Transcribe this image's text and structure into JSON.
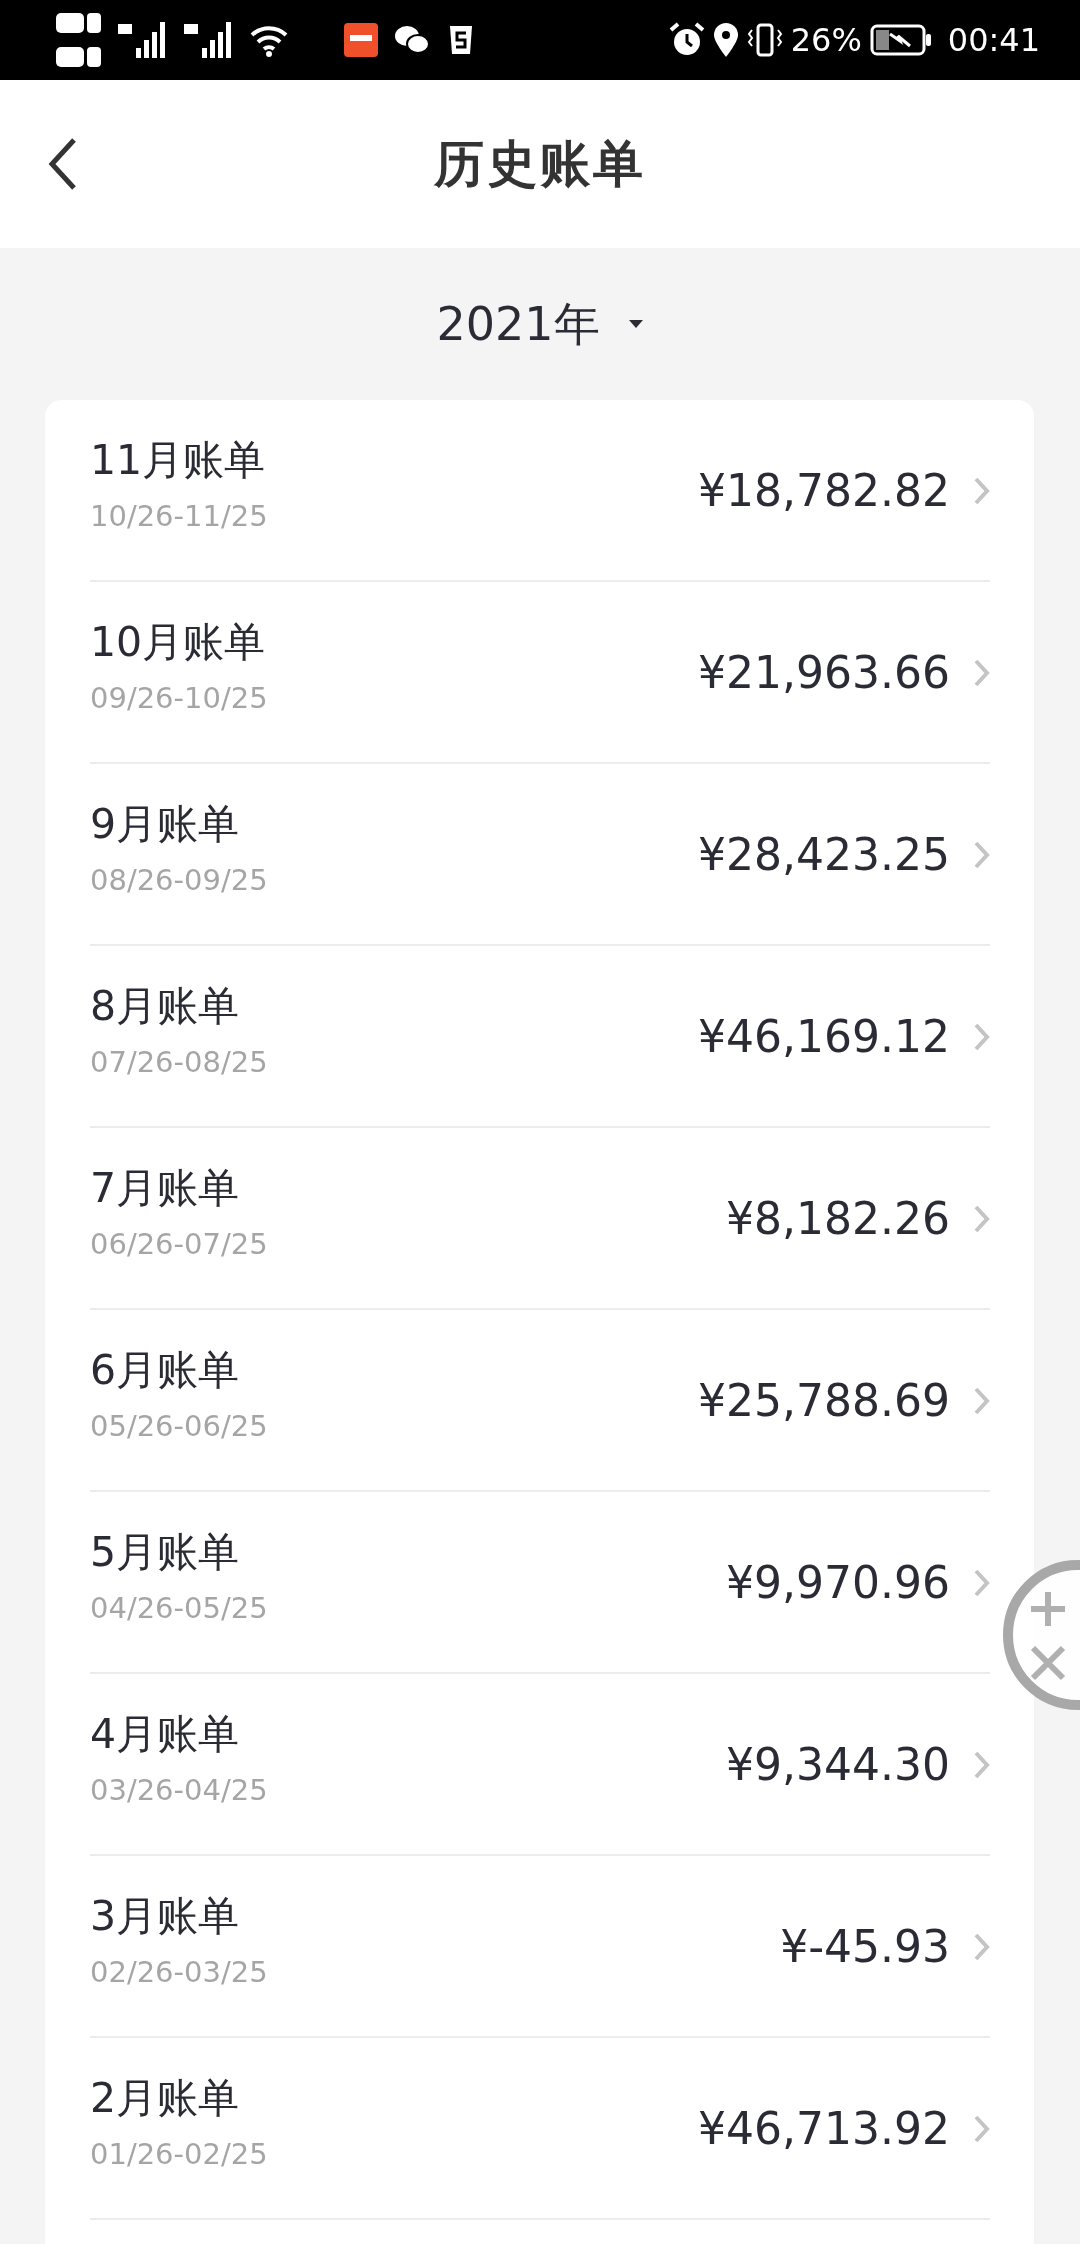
{
  "status_bar": {
    "battery_text": "26%",
    "time": "00:41"
  },
  "header": {
    "title": "历史账单"
  },
  "year_picker": {
    "label": "2021年"
  },
  "bills": [
    {
      "title": "11月账单",
      "period": "10/26-11/25",
      "amount": "¥18,782.82"
    },
    {
      "title": "10月账单",
      "period": "09/26-10/25",
      "amount": "¥21,963.66"
    },
    {
      "title": "9月账单",
      "period": "08/26-09/25",
      "amount": "¥28,423.25"
    },
    {
      "title": "8月账单",
      "period": "07/26-08/25",
      "amount": "¥46,169.12"
    },
    {
      "title": "7月账单",
      "period": "06/26-07/25",
      "amount": "¥8,182.26"
    },
    {
      "title": "6月账单",
      "period": "05/26-06/25",
      "amount": "¥25,788.69"
    },
    {
      "title": "5月账单",
      "period": "04/26-05/25",
      "amount": "¥9,970.96"
    },
    {
      "title": "4月账单",
      "period": "03/26-04/25",
      "amount": "¥9,344.30"
    },
    {
      "title": "3月账单",
      "period": "02/26-03/25",
      "amount": "¥-45.93"
    },
    {
      "title": "2月账单",
      "period": "01/26-02/25",
      "amount": "¥46,713.92"
    }
  ]
}
